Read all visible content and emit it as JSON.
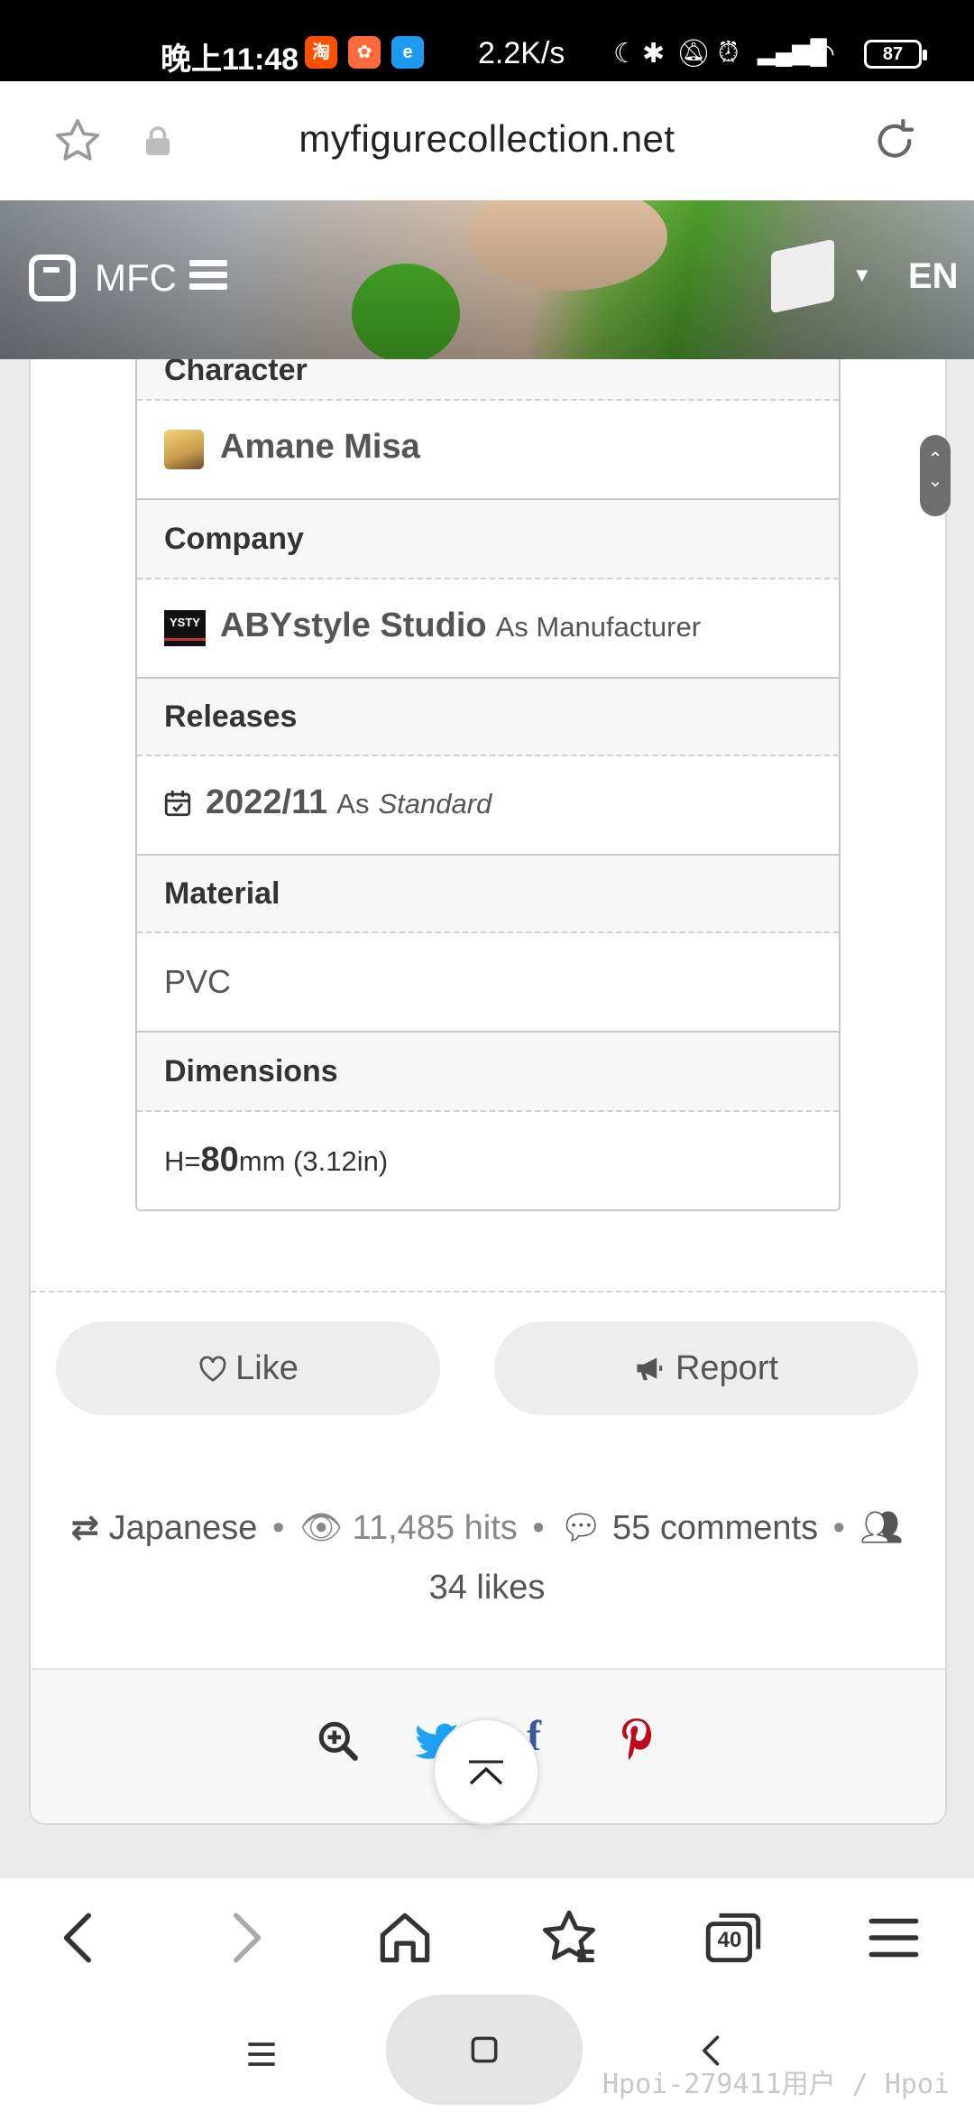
{
  "status_bar": {
    "time": "晚上11:48",
    "net_speed": "2.2K/s",
    "battery": "87",
    "app_icons": [
      "taobao-icon",
      "app-icon",
      "browser-icon"
    ],
    "indicator_icons": [
      "moon-icon",
      "bluetooth-icon",
      "mute-icon",
      "alarm-icon",
      "signal-icon",
      "wifi-icon"
    ]
  },
  "browser": {
    "url": "myfigurecollection.net"
  },
  "site_header": {
    "brand": "MFC",
    "language": "EN"
  },
  "details": {
    "character_heading": "Character",
    "character_name": "Amane Misa",
    "company_heading": "Company",
    "company_name": "ABYstyle Studio",
    "company_icon_text": "YSTY",
    "company_role": "As Manufacturer",
    "releases_heading": "Releases",
    "release_date": "2022/11",
    "release_prefix": "As",
    "release_type": "Standard",
    "material_heading": "Material",
    "material_value": "PVC",
    "dimensions_heading": "Dimensions",
    "dim_prefix": "H=",
    "dim_value": "80",
    "dim_unit": "mm (3.12in)"
  },
  "actions": {
    "like_label": "Like",
    "report_label": "Report"
  },
  "stats": {
    "language": "Japanese",
    "hits": "11,485 hits",
    "comments": "55 comments",
    "likes": "34 likes",
    "separator": "•"
  },
  "colors": {
    "twitter": "#1da1f2",
    "facebook": "#3b5998",
    "pinterest": "#bd081c"
  },
  "browser_nav": {
    "tabs_count": "40"
  },
  "watermark": "Hpoi-279411用户 / Hpoi"
}
